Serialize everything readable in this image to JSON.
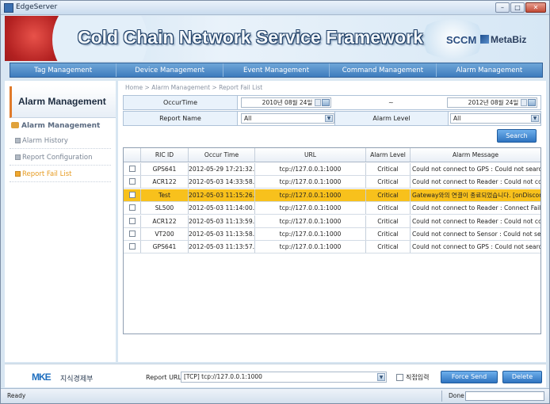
{
  "window": {
    "title": "EdgeServer",
    "minimize": "–",
    "maximize": "□",
    "close": "✕"
  },
  "banner": {
    "title": "Cold Chain Network Service Framework",
    "sccm": "SCCM",
    "brand": "MetaBiz"
  },
  "menu": [
    "Tag Management",
    "Device Management",
    "Event Management",
    "Command Management",
    "Alarm Management"
  ],
  "sidebar": {
    "header": "Alarm Management",
    "section": "Alarm Management",
    "items": [
      {
        "label": "Alarm History",
        "active": false
      },
      {
        "label": "Report Configuration",
        "active": false
      },
      {
        "label": "Report Fail List",
        "active": true
      }
    ]
  },
  "breadcrumb": "Home > Alarm Management > Report Fail List",
  "filters": {
    "occur_time_label": "OccurTime",
    "date_from": "2010년 08월 24일",
    "tilde": "~",
    "date_to": "2012년 08월 24일",
    "report_name_label": "Report Name",
    "report_name_value": "All",
    "alarm_level_label": "Alarm Level",
    "alarm_level_value": "All",
    "search": "Search"
  },
  "grid": {
    "columns": [
      "",
      "RIC ID",
      "Occur Time",
      "URL",
      "Alarm Level",
      "Alarm Message"
    ],
    "rows": [
      {
        "ric": "GPS641",
        "time": "2012-05-29 17:21:32.0",
        "url": "tcp://127.0.0.1:1000",
        "level": "Critical",
        "msg": "Could not connect to GPS : Could not search port ...",
        "selected": false
      },
      {
        "ric": "ACR122",
        "time": "2012-05-03 14:33:58.0",
        "url": "tcp://127.0.0.1:1000",
        "level": "Critical",
        "msg": "Could not connect to Reader : Could not connect t...",
        "selected": false
      },
      {
        "ric": "Test",
        "time": "2012-05-03 11:15:26.0",
        "url": "tcp://127.0.0.1:1000",
        "level": "Critical",
        "msg": "Gateway와의 연결이 종료되었습니다. [onDiscon...",
        "selected": true
      },
      {
        "ric": "SL500",
        "time": "2012-05-03 11:14:00.0",
        "url": "tcp://127.0.0.1:1000",
        "level": "Critical",
        "msg": "Could not connect to Reader : Connect Failure",
        "selected": false
      },
      {
        "ric": "ACR122",
        "time": "2012-05-03 11:13:59.0",
        "url": "tcp://127.0.0.1:1000",
        "level": "Critical",
        "msg": "Could not connect to Reader : Could not connect t...",
        "selected": false
      },
      {
        "ric": "VT200",
        "time": "2012-05-03 11:13:58.0",
        "url": "tcp://127.0.0.1:1000",
        "level": "Critical",
        "msg": "Could not connect to Sensor : Could not search p...",
        "selected": false
      },
      {
        "ric": "GPS641",
        "time": "2012-05-03 11:13:57.0",
        "url": "tcp://127.0.0.1:1000",
        "level": "Critical",
        "msg": "Could not connect to GPS : Could not search port ...",
        "selected": false
      }
    ]
  },
  "bottom": {
    "logo": "MKE",
    "logo_text": "지식경제부",
    "report_url_label": "Report URL",
    "report_url_value": "[TCP] tcp://127.0.0.1:1000",
    "direct_input_label": "직접입력",
    "force_send": "Force Send",
    "delete": "Delete"
  },
  "status": {
    "left": "Ready",
    "right": "Done"
  },
  "colors": {
    "accent": "#3e7cbe",
    "selected_row": "#f8c11c",
    "active_item": "#e69a1f"
  }
}
